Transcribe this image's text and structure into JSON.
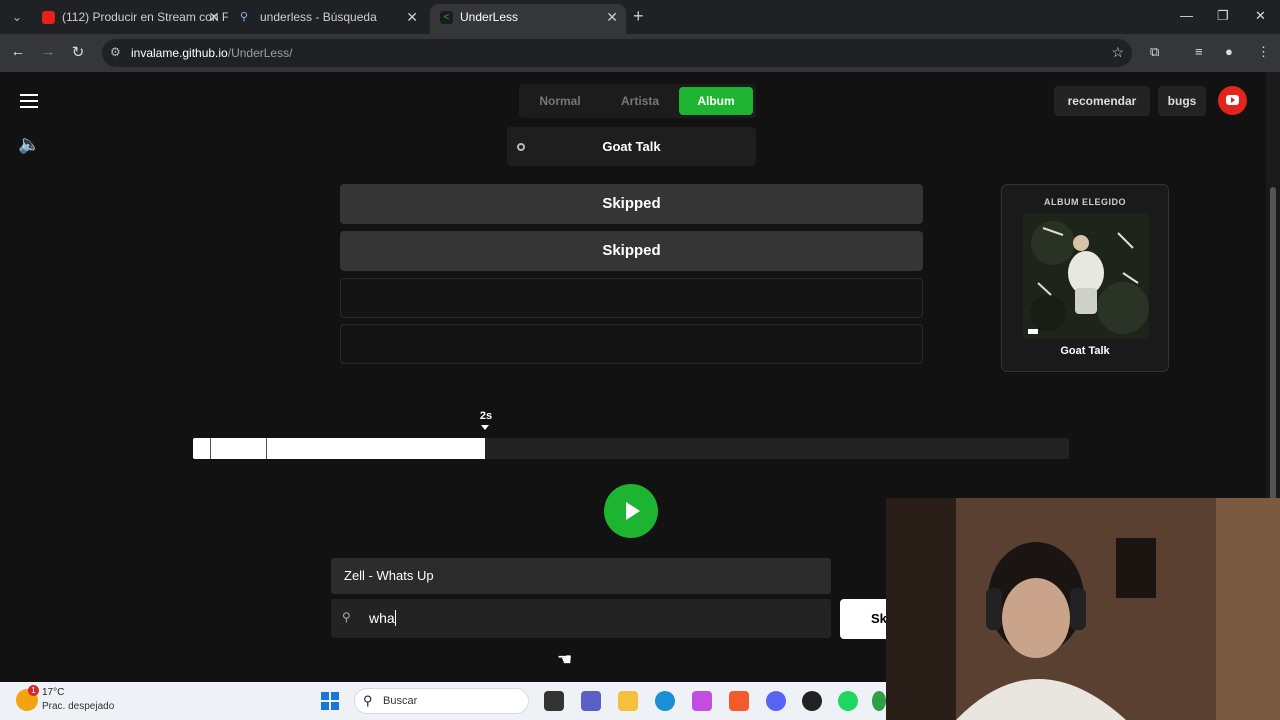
{
  "browser": {
    "tabs": [
      {
        "title": "(112) Producir en Stream con Fl",
        "favicon": "youtube-icon"
      },
      {
        "title": "underless - Búsqueda",
        "favicon": "search-icon"
      },
      {
        "title": "UnderLess",
        "favicon": "underless-icon",
        "active": true
      }
    ],
    "url_host": "invalame.github.io",
    "url_path": "/UnderLess/"
  },
  "app": {
    "modes": [
      "Normal",
      "Artista",
      "Album"
    ],
    "active_mode": "Album",
    "selected_album": "Goat Talk",
    "guesses": [
      "Skipped",
      "Skipped",
      "",
      ""
    ],
    "side_card": {
      "header": "ALBUM ELEGIDO",
      "title": "Goat Talk"
    },
    "timer_label": "2s",
    "progress_fraction": 0.333,
    "suggestion": "Zell - Whats Up",
    "search_value": "wha",
    "skip_label": "Sk",
    "top_right": {
      "recommend_label": "recomendar",
      "bugs_label": "bugs"
    }
  },
  "taskbar": {
    "temperature": "17°C",
    "weather": "Prac. despejado",
    "weather_badge": "1",
    "search_placeholder": "Buscar"
  },
  "colors": {
    "accent_green": "#1db431",
    "youtube_red": "#e1251b"
  }
}
